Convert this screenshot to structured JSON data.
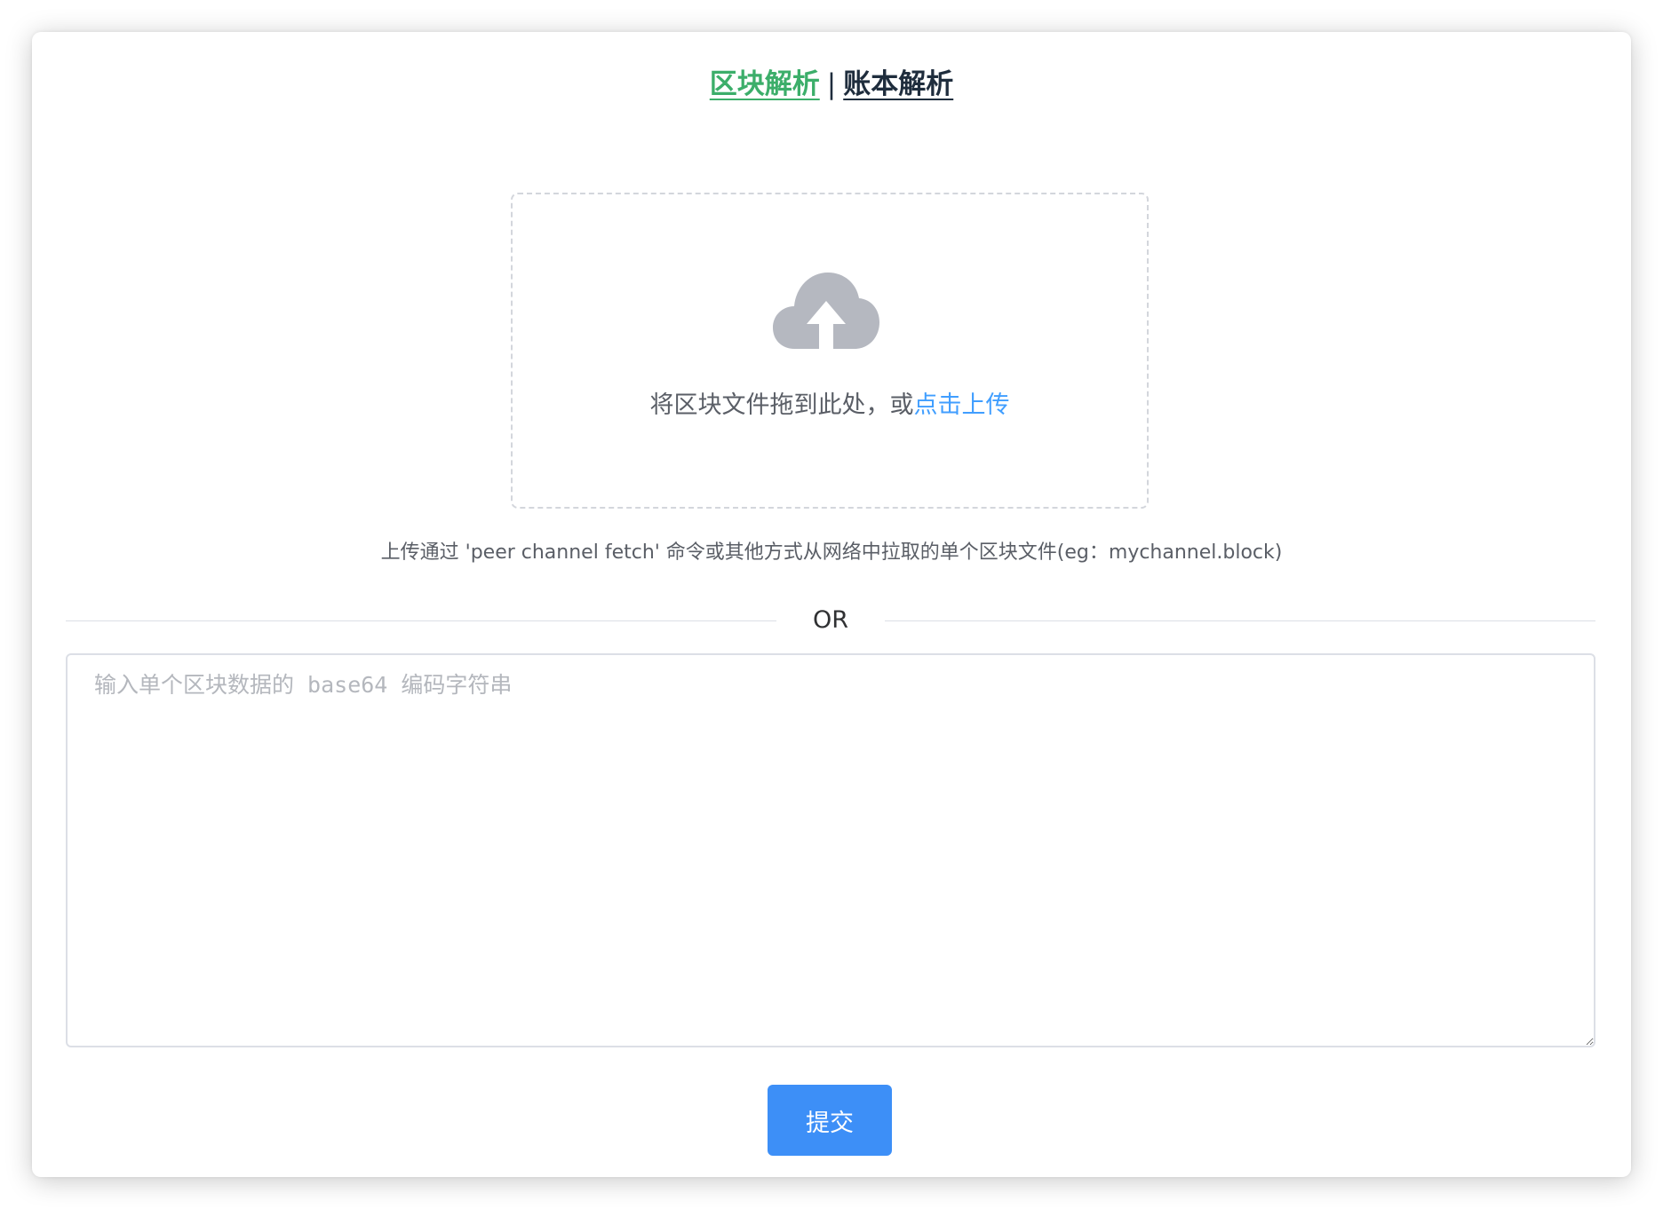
{
  "nav": {
    "block_parse": "区块解析",
    "separator": "|",
    "ledger_parse": "账本解析"
  },
  "upload": {
    "icon": "cloud-upload-icon",
    "prompt": "将区块文件拖到此处，或",
    "link": "点击上传",
    "hint": "上传通过 'peer channel fetch' 命令或其他方式从网络中拉取的单个区块文件(eg：mychannel.block)"
  },
  "divider": {
    "text": "OR"
  },
  "input": {
    "placeholder": "输入单个区块数据的 base64 编码字符串",
    "value": ""
  },
  "actions": {
    "submit_label": "提交"
  },
  "colors": {
    "active_tab": "#3cae6a",
    "link": "#409eff",
    "primary_button": "#3d8ff7",
    "icon_gray": "#b5b8c0"
  }
}
